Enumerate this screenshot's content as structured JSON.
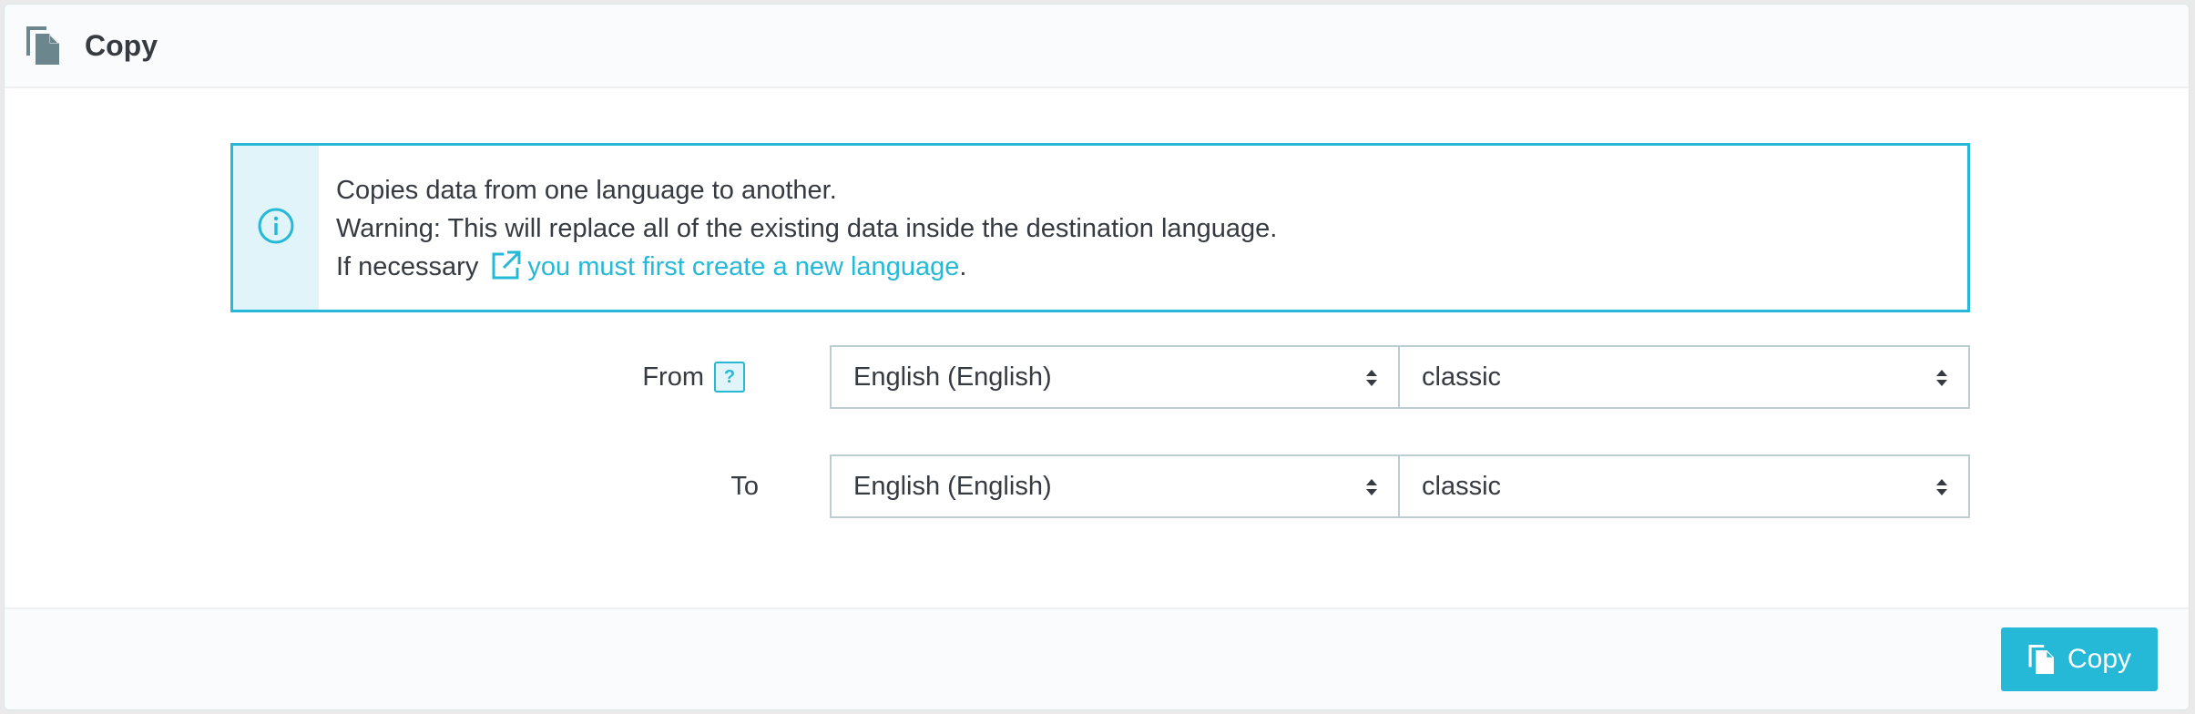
{
  "panel": {
    "title": "Copy",
    "title_icon": "copy-icon"
  },
  "alert": {
    "icon": "info-icon",
    "line1": "Copies data from one language to another.",
    "line2": "Warning: This will replace all of the existing data inside the destination language.",
    "line3_prefix": "If necessary",
    "link_icon": "external-link-icon",
    "link_text": "you must first create a new language",
    "line3_suffix": "."
  },
  "form": {
    "from": {
      "label": "From",
      "help": "?",
      "language": "English (English)",
      "theme": "classic"
    },
    "to": {
      "label": "To",
      "language": "English (English)",
      "theme": "classic"
    }
  },
  "footer": {
    "copy_button": "Copy",
    "copy_button_icon": "copy-icon"
  },
  "colors": {
    "accent": "#25b9d7",
    "text": "#363a41",
    "alert_bg": "#e0f4f9",
    "border": "#bbcdd2"
  }
}
